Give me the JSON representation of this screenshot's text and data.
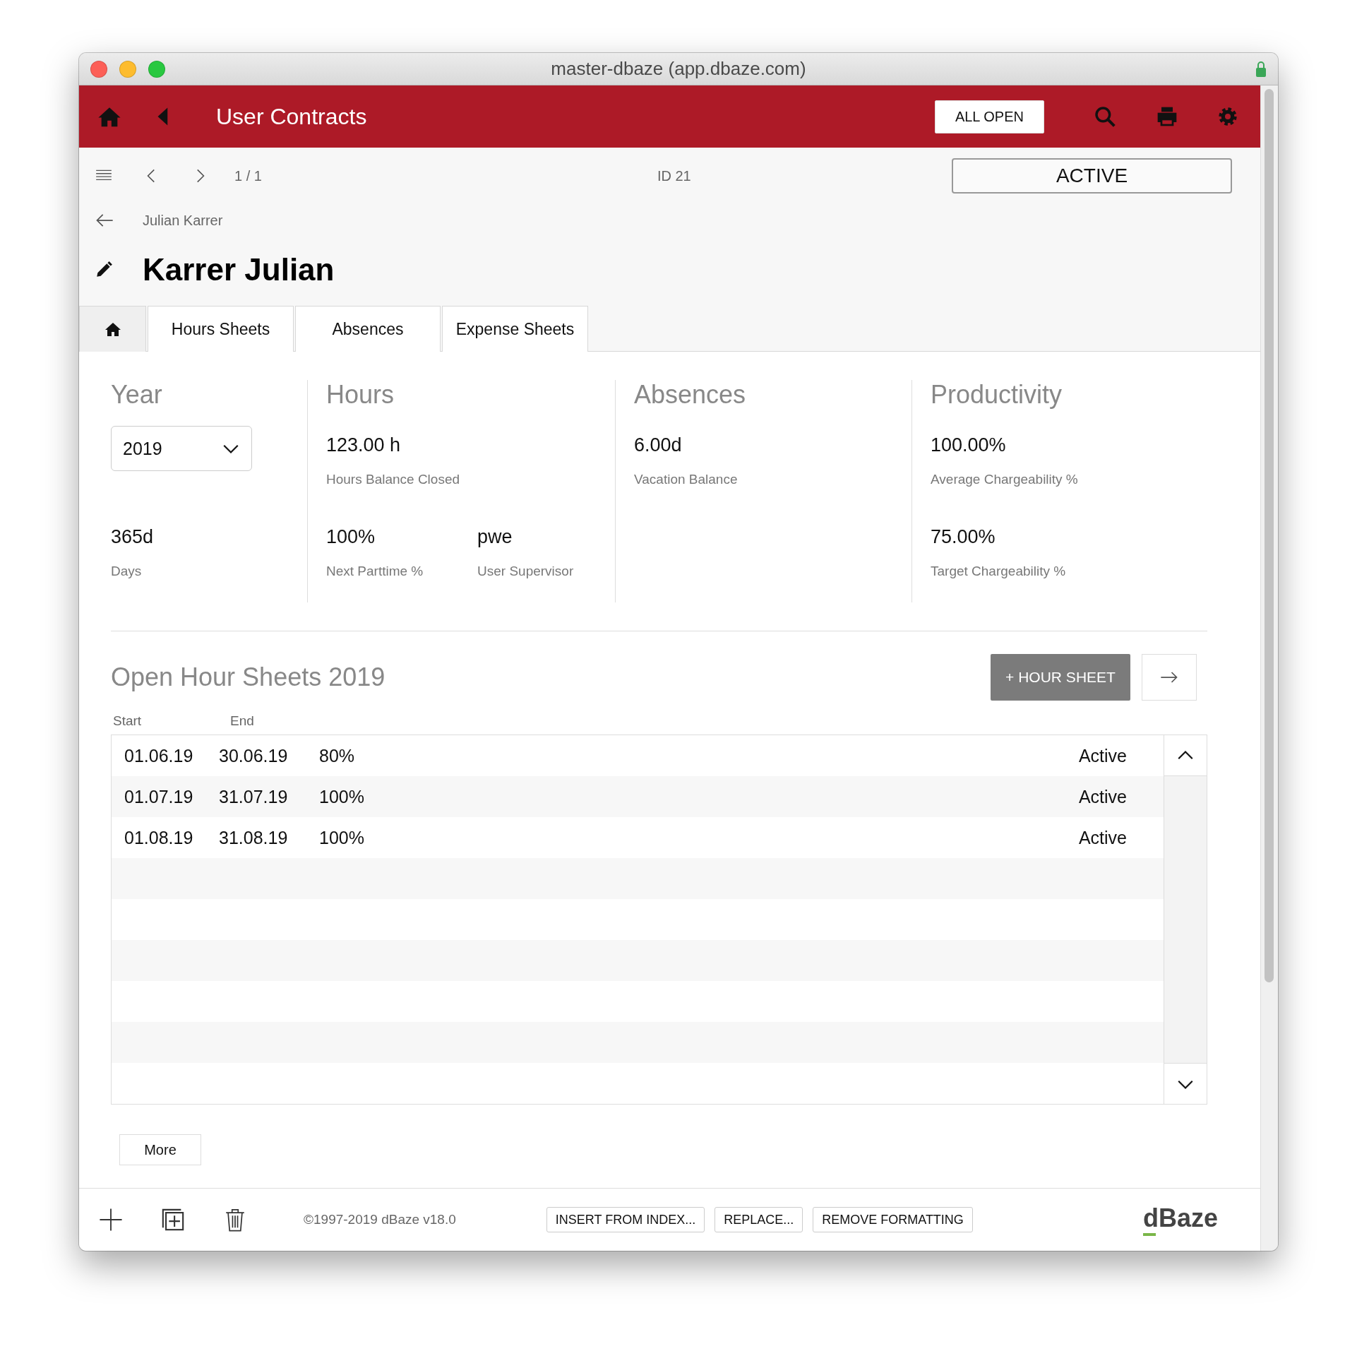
{
  "window": {
    "title": "master-dbaze (app.dbaze.com)"
  },
  "header": {
    "title": "User Contracts",
    "all_open_button": "ALL OPEN"
  },
  "toolbar": {
    "record_position": "1 / 1",
    "record_id": "ID 21",
    "status": "ACTIVE"
  },
  "breadcrumb": "Julian Karrer",
  "record_title": "Karrer Julian",
  "tabs": [
    {
      "kind": "icon",
      "selected": true
    },
    {
      "kind": "text",
      "label": "Hours Sheets",
      "selected": false
    },
    {
      "kind": "text",
      "label": "Absences",
      "selected": false
    },
    {
      "kind": "text",
      "label": "Expense Sheets",
      "selected": false
    }
  ],
  "stat_groups": [
    {
      "title": "Year",
      "kind": "select",
      "select_value": "2019",
      "fields": [
        {
          "value": "365d",
          "label": "Days"
        }
      ]
    },
    {
      "title": "Hours",
      "kind": "fields",
      "fields": [
        {
          "value": "123.00 h",
          "label": "Hours Balance Closed"
        },
        {
          "value": "100%",
          "label": "Next Parttime %"
        },
        {
          "value": "pwe",
          "label": "User Supervisor"
        }
      ]
    },
    {
      "title": "Absences",
      "kind": "fields",
      "fields": [
        {
          "value": "6.00d",
          "label": "Vacation Balance"
        }
      ]
    },
    {
      "title": "Productivity",
      "kind": "fields",
      "fields": [
        {
          "value": "100.00%",
          "label": "Average Chargeability %"
        },
        {
          "value": "75.00%",
          "label": "Target Chargeability %"
        }
      ]
    }
  ],
  "hour_sheets": {
    "title": "Open Hour Sheets 2019",
    "add_button": "+ HOUR SHEET",
    "columns": [
      "Start",
      "End"
    ],
    "rows": [
      {
        "cells": [
          "01.06.19",
          "30.06.19",
          "80%",
          "Active"
        ]
      },
      {
        "cells": [
          "01.07.19",
          "31.07.19",
          "100%",
          "Active"
        ]
      },
      {
        "cells": [
          "01.08.19",
          "31.08.19",
          "100%",
          "Active"
        ]
      }
    ],
    "more_button": "More"
  },
  "footer": {
    "copyright": "©1997-2019 dBaze v18.0",
    "buttons": [
      "INSERT FROM INDEX...",
      "REPLACE...",
      "REMOVE FORMATTING"
    ],
    "logo": "dBaze"
  }
}
